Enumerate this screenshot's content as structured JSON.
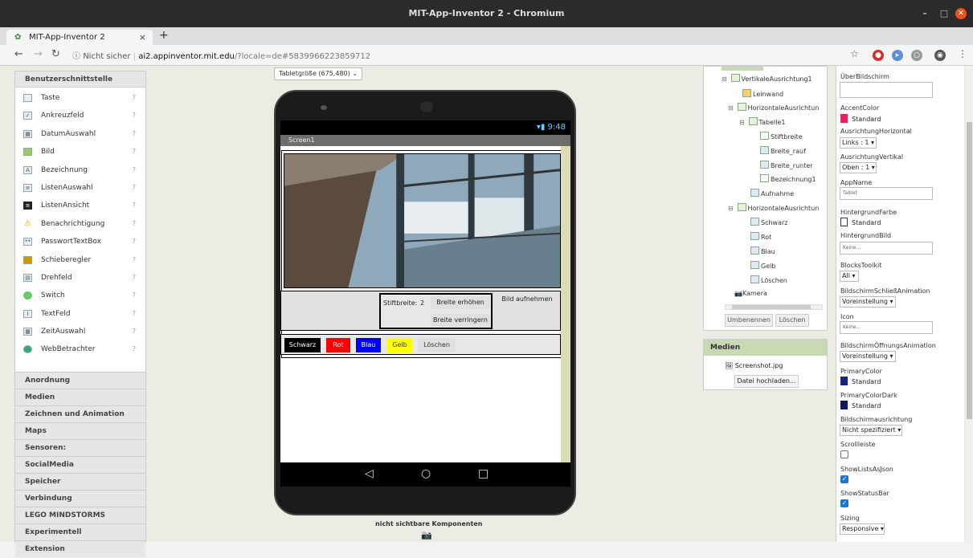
{
  "window": {
    "title": "MIT-App-Inventor 2 - Chromium"
  },
  "browser": {
    "tab_title": "MIT-App-Inventor 2",
    "tab_close": "×",
    "new_tab": "+",
    "security": "Nicht sicher",
    "url_host": "ai2.appinventor.mit.edu",
    "url_rest": "/?locale=de#5839966223859712"
  },
  "palette": {
    "header": "Benutzerschnittstelle",
    "items": [
      {
        "label": "Taste",
        "icon": "button-icon"
      },
      {
        "label": "Ankreuzfeld",
        "icon": "checkbox-icon"
      },
      {
        "label": "DatumAuswahl",
        "icon": "datepicker-icon"
      },
      {
        "label": "Bild",
        "icon": "image-icon"
      },
      {
        "label": "Bezeichnung",
        "icon": "label-icon"
      },
      {
        "label": "ListenAuswahl",
        "icon": "listpicker-icon"
      },
      {
        "label": "ListenAnsicht",
        "icon": "listview-icon"
      },
      {
        "label": "Benachrichtigung",
        "icon": "notifier-icon"
      },
      {
        "label": "PasswortTextBox",
        "icon": "password-icon"
      },
      {
        "label": "Schieberegler",
        "icon": "slider-icon"
      },
      {
        "label": "Drehfeld",
        "icon": "spinner-icon"
      },
      {
        "label": "Switch",
        "icon": "switch-icon"
      },
      {
        "label": "TextFeld",
        "icon": "textbox-icon"
      },
      {
        "label": "ZeitAuswahl",
        "icon": "timepicker-icon"
      },
      {
        "label": "WebBetrachter",
        "icon": "webviewer-icon"
      }
    ],
    "help_glyph": "?",
    "categories": [
      "Anordnung",
      "Medien",
      "Zeichnen und Animation",
      "Maps",
      "Sensoren:",
      "SocialMedia",
      "Speicher",
      "Verbindung",
      "LEGO MINDSTORMS",
      "Experimentell",
      "Extension"
    ]
  },
  "viewer": {
    "size_select": "Tabletgröße (675,480)",
    "status_time": "9:48",
    "screen_title": "Screen1",
    "stift_label": "Stiftbreite:",
    "stift_value": "2",
    "breite_erhoehen": "Breite erhöhen",
    "breite_verringern": "Breite verringern",
    "bild_aufnehmen": "Bild aufnehmen",
    "color_buttons": [
      {
        "label": "Schwarz",
        "bg": "#000000",
        "fg": "#ffffff"
      },
      {
        "label": "Rot",
        "bg": "#ff0000",
        "fg": "#ffffff"
      },
      {
        "label": "Blau",
        "bg": "#0000ff",
        "fg": "#ffffff"
      },
      {
        "label": "Gelb",
        "bg": "#ffff00",
        "fg": "#333333"
      },
      {
        "label": "Löschen",
        "bg": "#e0e0e0",
        "fg": "#333333"
      }
    ],
    "invisible_label": "nicht sichtbare Komponenten"
  },
  "tree": {
    "nodes": [
      "VertikaleAusrichtung1",
      "Leinwand",
      "HorizontaleAusrichtun",
      "Tabelle1",
      "Stiftbreite",
      "Breite_rauf",
      "Breite_runter",
      "Bezeichnung1",
      "Aufnahme",
      "HorizontaleAusrichtun",
      "Schwarz",
      "Rot",
      "Blau",
      "Gelb",
      "Löschen",
      "Kamera"
    ],
    "rename_button": "Umbenennen",
    "delete_button": "Löschen"
  },
  "media": {
    "header": "Medien",
    "file": "Screenshot.jpg",
    "upload_button": "Datei hochladen..."
  },
  "properties": {
    "ueberbildschirm": "ÜberBildschirm",
    "accentcolor_label": "AccentColor",
    "accentcolor_value": "Standard",
    "ah_label": "AusrichtungHorizontal",
    "ah_value": "Links : 1 ▾",
    "av_label": "AusrichtungVertikal",
    "av_value": "Oben : 1 ▾",
    "appname_label": "AppName",
    "appname_value": "Tablet",
    "hgfarbe_label": "HintergrundFarbe",
    "hgfarbe_value": "Standard",
    "hgbild_label": "HintergrundBild",
    "hgbild_value": "Keine...",
    "blocks_label": "BlocksToolkit",
    "blocks_value": "All ▾",
    "bsa_label": "BildschirmSchließAnimation",
    "bsa_value": "Voreinstellung ▾",
    "icon_label": "Icon",
    "icon_value": "Keine...",
    "boa_label": "BildschirmÖffnungsAnimation",
    "boa_value": "Voreinstellung ▾",
    "primary_label": "PrimaryColor",
    "primary_value": "Standard",
    "primarydark_label": "PrimaryColorDark",
    "primarydark_value": "Standard",
    "orient_label": "Bildschirmausrichtung",
    "orient_value": "Nicht spezifiziert ▾",
    "scroll_label": "Scrollleiste",
    "showlists_label": "ShowListsAsJson",
    "showstatus_label": "ShowStatusBar",
    "sizing_label": "Sizing",
    "sizing_value": "Responsive ▾",
    "colors": {
      "accent": "#e0245e",
      "primary": "#1a237e",
      "primarydark": "#0d1b5a"
    }
  }
}
